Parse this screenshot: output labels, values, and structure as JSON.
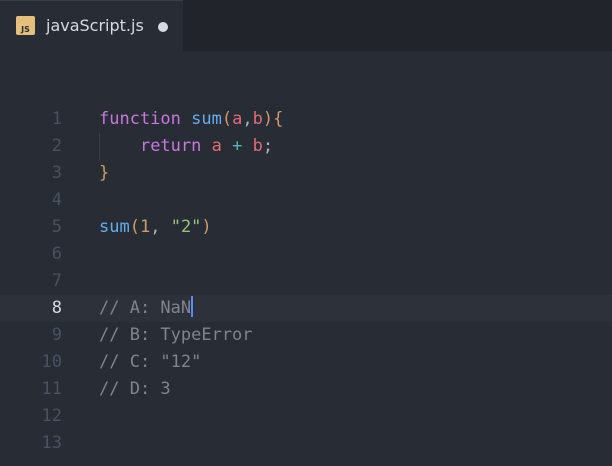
{
  "tab": {
    "icon_label": "JS",
    "title": "javaScript.js"
  },
  "editor": {
    "active_line": 8,
    "lines": [
      {
        "number": "1",
        "tokens": [
          {
            "t": "function",
            "c": "kw"
          },
          {
            "t": " ",
            "c": "pu"
          },
          {
            "t": "sum",
            "c": "fn"
          },
          {
            "t": "(",
            "c": "br"
          },
          {
            "t": "a",
            "c": "pr"
          },
          {
            "t": ",",
            "c": "pu"
          },
          {
            "t": "b",
            "c": "pr"
          },
          {
            "t": ")",
            "c": "br"
          },
          {
            "t": "{",
            "c": "br"
          }
        ]
      },
      {
        "number": "2",
        "tokens": [
          {
            "t": "    ",
            "c": "pu"
          },
          {
            "t": "return",
            "c": "kw"
          },
          {
            "t": " ",
            "c": "pu"
          },
          {
            "t": "a",
            "c": "pr"
          },
          {
            "t": " ",
            "c": "pu"
          },
          {
            "t": "+",
            "c": "op"
          },
          {
            "t": " ",
            "c": "pu"
          },
          {
            "t": "b",
            "c": "pr"
          },
          {
            "t": ";",
            "c": "pu"
          }
        ]
      },
      {
        "number": "3",
        "tokens": [
          {
            "t": "}",
            "c": "br"
          }
        ]
      },
      {
        "number": "4",
        "tokens": []
      },
      {
        "number": "5",
        "tokens": [
          {
            "t": "sum",
            "c": "fn"
          },
          {
            "t": "(",
            "c": "br"
          },
          {
            "t": "1",
            "c": "nm"
          },
          {
            "t": ", ",
            "c": "pu"
          },
          {
            "t": "\"2\"",
            "c": "st"
          },
          {
            "t": ")",
            "c": "br"
          }
        ]
      },
      {
        "number": "6",
        "tokens": []
      },
      {
        "number": "7",
        "tokens": []
      },
      {
        "number": "8",
        "tokens": [
          {
            "t": "// A: NaN",
            "c": "cm"
          }
        ]
      },
      {
        "number": "9",
        "tokens": [
          {
            "t": "// B: TypeError",
            "c": "cm"
          }
        ]
      },
      {
        "number": "10",
        "tokens": [
          {
            "t": "// C: \"12\"",
            "c": "cm"
          }
        ]
      },
      {
        "number": "11",
        "tokens": [
          {
            "t": "// D: 3",
            "c": "cm"
          }
        ]
      },
      {
        "number": "12",
        "tokens": []
      },
      {
        "number": "13",
        "tokens": []
      }
    ]
  },
  "colors": {
    "editor_bg": "#282c34",
    "tabbar_bg": "#21252b",
    "keyword": "#c678dd",
    "function": "#61afef",
    "param": "#e06c75",
    "operator": "#56b6c2",
    "number": "#d19a66",
    "string": "#98c379",
    "comment": "#7f848e",
    "cursor": "#528bff"
  }
}
